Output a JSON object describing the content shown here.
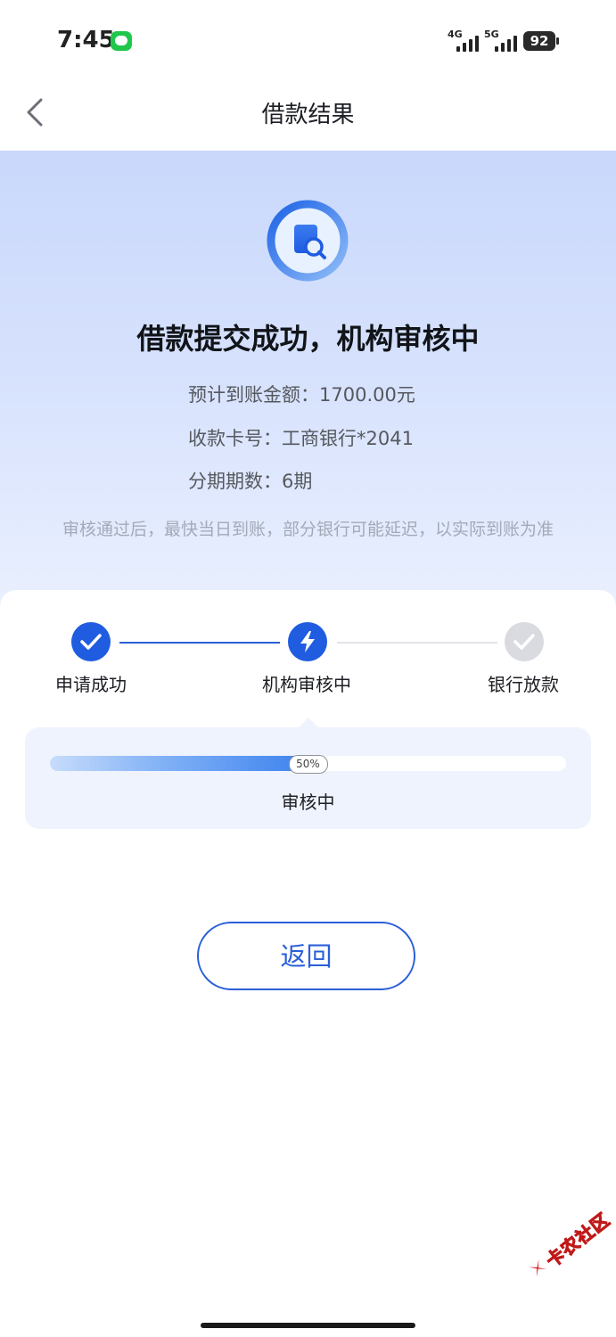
{
  "status_bar": {
    "time": "7:45",
    "signal1_label": "4G",
    "signal2_label": "5G",
    "battery": "92"
  },
  "header": {
    "title": "借款结果"
  },
  "result": {
    "title": "借款提交成功，机构审核中",
    "amount_line": "预计到账金额：1700.00元",
    "card_line": "收款卡号：工商银行*2041",
    "installments_line": "分期期数：6期",
    "hint": "审核通过后，最快当日到账，部分银行可能延迟，以实际到账为准"
  },
  "steps": [
    {
      "label": "申请成功",
      "state": "done"
    },
    {
      "label": "机构审核中",
      "state": "active"
    },
    {
      "label": "银行放款",
      "state": "pending"
    }
  ],
  "progress": {
    "percent": 50,
    "percent_label": "50%",
    "status": "审核中"
  },
  "actions": {
    "return_label": "返回"
  },
  "watermark": {
    "text": "卡农社区"
  },
  "colors": {
    "accent": "#1f5ce0",
    "pending": "#d9dbe0",
    "hero_bg": "#c9d8fb"
  }
}
